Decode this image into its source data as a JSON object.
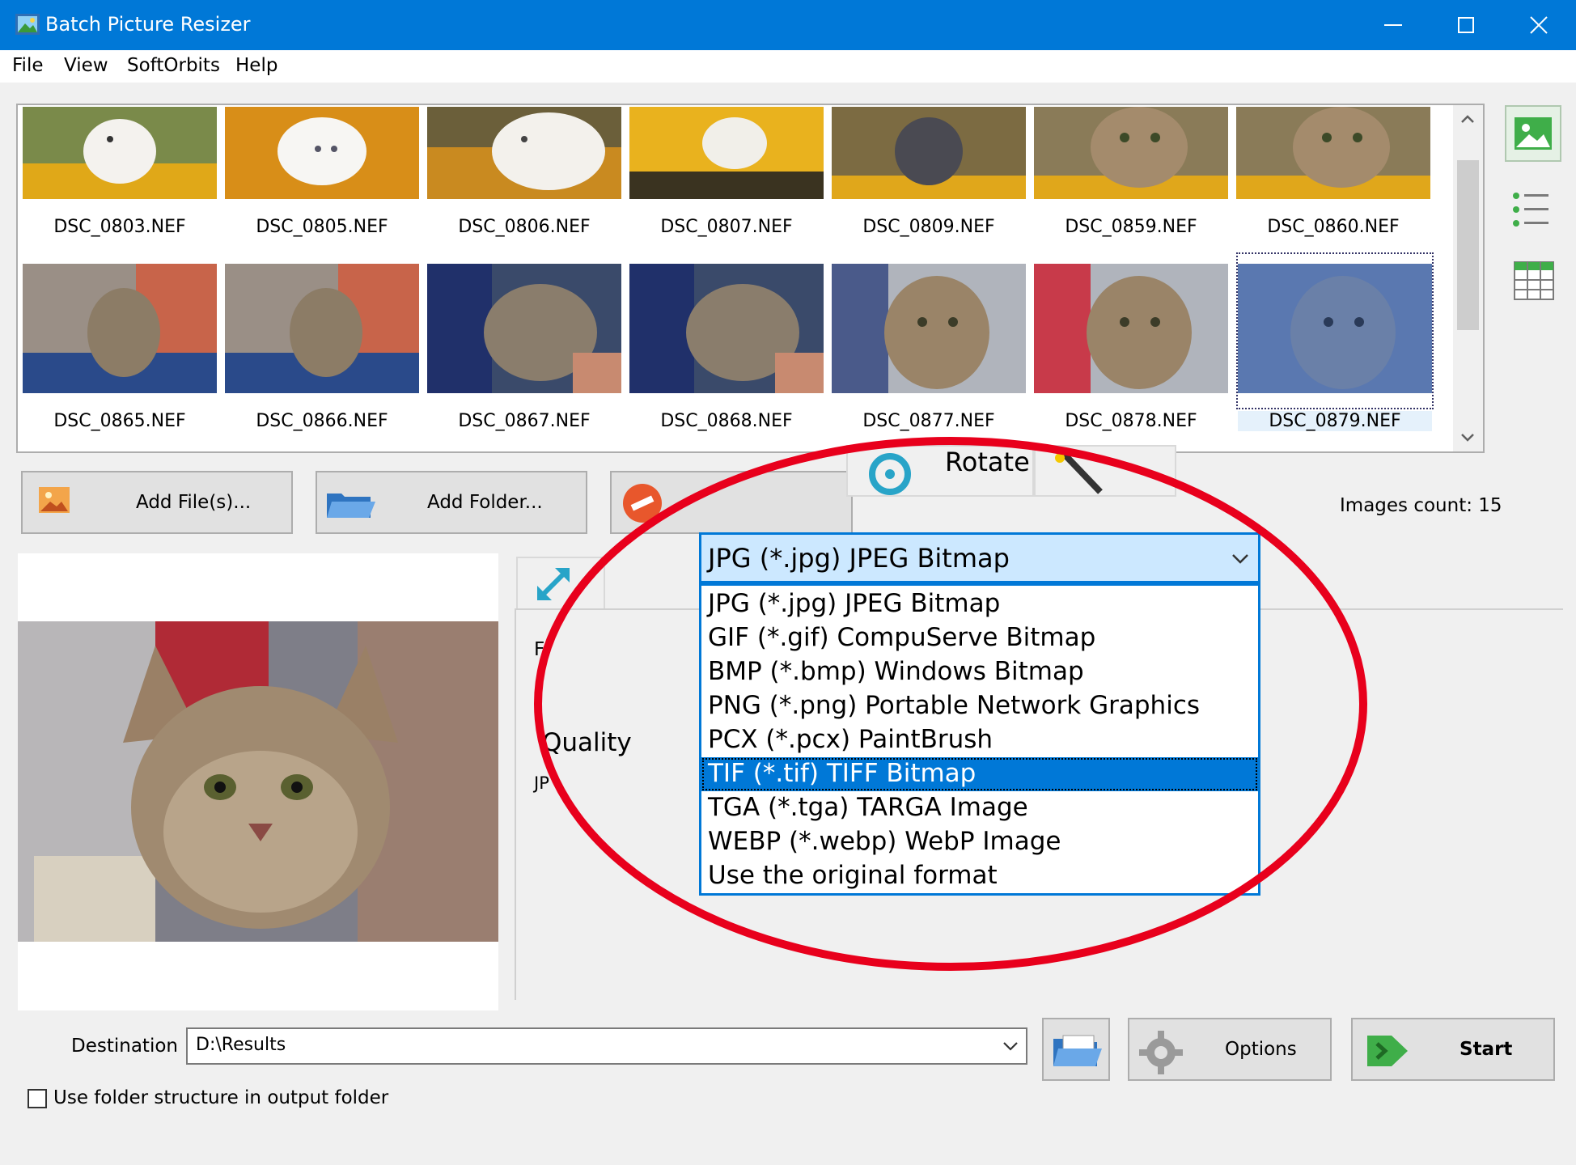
{
  "window": {
    "title": "Batch Picture Resizer"
  },
  "menu": [
    "File",
    "View",
    "SoftOrbits",
    "Help"
  ],
  "thumbnails": [
    "DSC_0803.NEF",
    "DSC_0805.NEF",
    "DSC_0806.NEF",
    "DSC_0807.NEF",
    "DSC_0809.NEF",
    "DSC_0859.NEF",
    "DSC_0860.NEF",
    "DSC_0865.NEF",
    "DSC_0866.NEF",
    "DSC_0867.NEF",
    "DSC_0868.NEF",
    "DSC_0877.NEF",
    "DSC_0878.NEF",
    "DSC_0879.NEF"
  ],
  "buttons": {
    "add_files": "Add File(s)...",
    "add_folder": "Add Folder...",
    "options": "Options",
    "start": "Start"
  },
  "tabs": {
    "rotate": "Rotate"
  },
  "images_count": "Images count: 15",
  "settings": {
    "quality_label": "Quality",
    "partial_label_f": "F",
    "partial_label_jp": "JP"
  },
  "format": {
    "selected": "JPG (*.jpg) JPEG Bitmap",
    "options": [
      "JPG (*.jpg) JPEG Bitmap",
      "GIF (*.gif) CompuServe Bitmap",
      "BMP (*.bmp) Windows Bitmap",
      "PNG (*.png) Portable Network Graphics",
      "PCX (*.pcx) PaintBrush",
      "TIF (*.tif) TIFF Bitmap",
      "TGA (*.tga) TARGA Image",
      "WEBP (*.webp) WebP Image",
      "Use the original format"
    ],
    "highlighted": "TIF (*.tif) TIFF Bitmap"
  },
  "destination": {
    "label": "Destination",
    "value": "D:\\Results"
  },
  "use_folder_structure": {
    "label": "Use folder structure in output folder",
    "checked": false
  },
  "colors": {
    "titlebar": "#0078d7",
    "highlight": "#0078d7",
    "annotation": "#e8001c"
  }
}
